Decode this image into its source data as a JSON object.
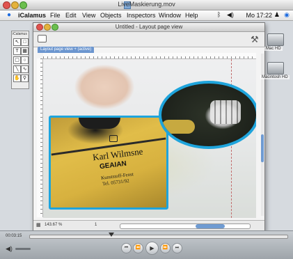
{
  "quicktime": {
    "title": "LiveMaskierung.mov",
    "timecode": "00:03:15",
    "controls": {
      "rewind_start": "⏮",
      "rewind": "⏪",
      "play": "▶",
      "forward": "⏩",
      "forward_end": "⏭"
    }
  },
  "menubar": {
    "apple": "",
    "items": [
      "iCalamus",
      "File",
      "Edit",
      "View",
      "Objects",
      "Inspectors",
      "Window",
      "Help"
    ],
    "status": "Mo 17:22"
  },
  "tool_palette": {
    "title": "iCalamus"
  },
  "document": {
    "title": "Untitled - Layout page view",
    "view_tab": "Layout page view + (active)",
    "zoom": "143.67 %",
    "page": "1"
  },
  "artwork": {
    "sponsor_name": "Karl Wilmsne",
    "sponsor_brand": "GEAIAN",
    "sponsor_line1": "Kunststoff-Fenst",
    "sponsor_line2": "Tel. 05731/92"
  },
  "desktop": {
    "disk1": "Mac HD",
    "disk2": "Macintosh HD"
  },
  "colors": {
    "accent": "#1ea4dc",
    "selection": "#6f9bd2"
  }
}
